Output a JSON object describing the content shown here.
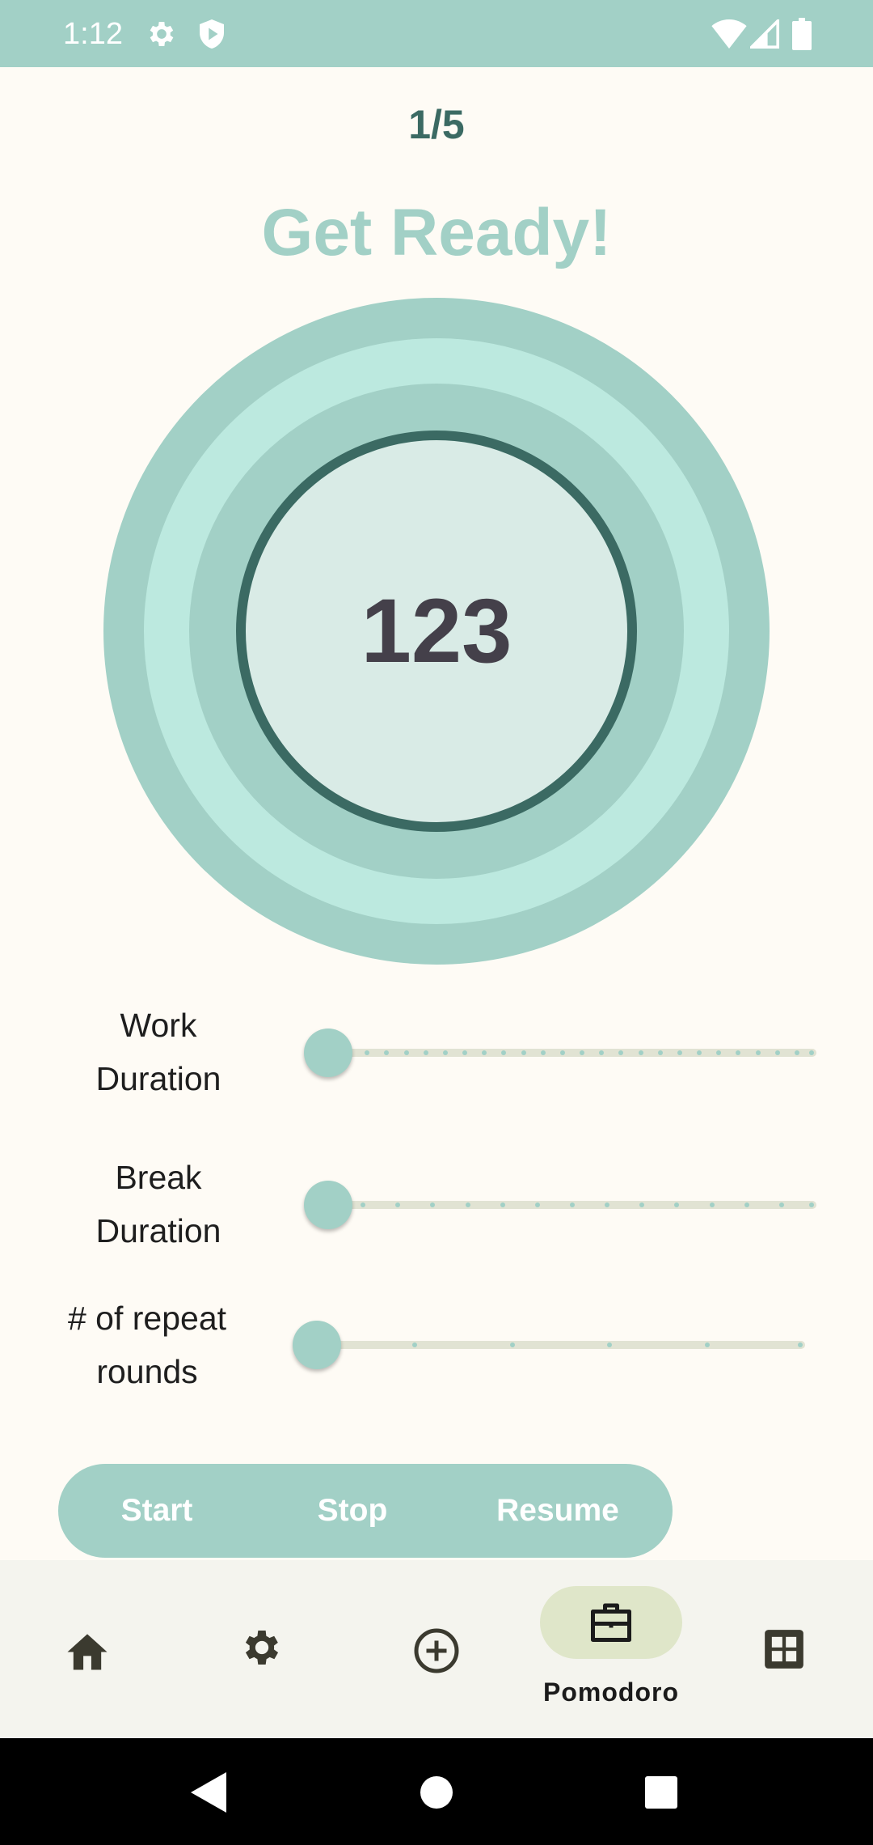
{
  "status_bar": {
    "time": "1:12",
    "icons": [
      "settings-icon",
      "shield-play-icon",
      "wifi-icon",
      "signal-icon",
      "battery-icon"
    ]
  },
  "header": {
    "round_counter": "1/5",
    "headline": "Get Ready!"
  },
  "timer": {
    "value": "123"
  },
  "sliders": [
    {
      "label_line1": "Work",
      "label_line2": "Duration",
      "value_fraction": 0
    },
    {
      "label_line1": "Break",
      "label_line2": "Duration",
      "value_fraction": 0
    },
    {
      "label_line1": "# of repeat",
      "label_line2": "rounds",
      "value_fraction": 0
    }
  ],
  "controls": {
    "start_label": "Start",
    "stop_label": "Stop",
    "resume_label": "Resume"
  },
  "bottom_nav": {
    "items": [
      {
        "icon": "home-icon",
        "label": ""
      },
      {
        "icon": "gear-icon",
        "label": ""
      },
      {
        "icon": "add-circle-icon",
        "label": ""
      },
      {
        "icon": "briefcase-icon",
        "label": "Pomodoro",
        "selected": true
      },
      {
        "icon": "grid-icon",
        "label": ""
      }
    ],
    "selected_label": "Pomodoro"
  },
  "system_nav": {
    "buttons": [
      "back-icon",
      "home-circle-icon",
      "recents-icon"
    ]
  },
  "colors": {
    "accent": "#a2d0c6",
    "accent_light": "#bce9df",
    "timer_fill": "#d9ebe6",
    "timer_ring": "#3b6a63",
    "background": "#fefbf5",
    "nav_background": "#f4f4ee",
    "nav_pill": "#dfe6c9",
    "timer_text": "#44404a"
  }
}
